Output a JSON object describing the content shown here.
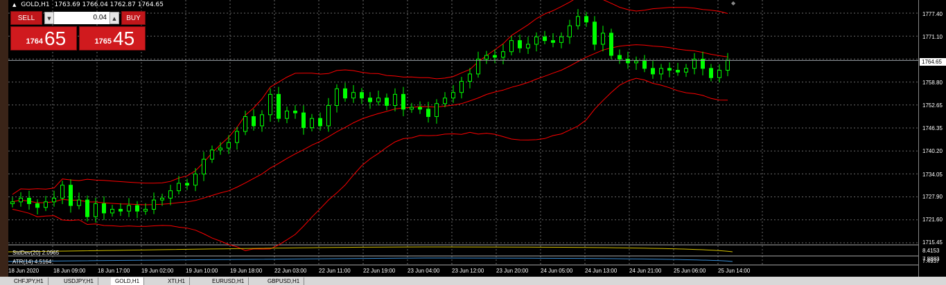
{
  "window": {
    "title": "GOLD,H1",
    "ohlc": "1763.69 1766.04 1762.87 1764.65"
  },
  "trade_panel": {
    "sell_label": "SELL",
    "buy_label": "BUY",
    "lot": "0.04",
    "sell_base": "1764",
    "sell_pips": "65",
    "buy_base": "1765",
    "buy_pips": "45"
  },
  "price_scale": {
    "ticks": [
      "1777.40",
      "1771.10",
      "1764.65",
      "1758.80",
      "1752.65",
      "1746.35",
      "1740.20",
      "1734.05",
      "1727.90",
      "1721.60",
      "1715.45"
    ],
    "current_price": "1764.65",
    "ind_ticks": [
      "8.4153",
      "7.8883",
      "7.4937"
    ]
  },
  "indicators": {
    "stddev_label": "StdDev(20) 2.0965",
    "atr_label": "ATR(14) 4.5164"
  },
  "time_axis": [
    "18 Jun 2020",
    "18 Jun 09:00",
    "18 Jun 17:00",
    "19 Jun 02:00",
    "19 Jun 10:00",
    "19 Jun 18:00",
    "22 Jun 03:00",
    "22 Jun 11:00",
    "22 Jun 19:00",
    "23 Jun 04:00",
    "23 Jun 12:00",
    "23 Jun 20:00",
    "24 Jun 05:00",
    "24 Jun 13:00",
    "24 Jun 21:00",
    "25 Jun 06:00",
    "25 Jun 14:00"
  ],
  "tabs": [
    "CHFJPY,H1",
    "USDJPY,H1",
    "GOLD,H1",
    "XTI,H1",
    "EURUSD,H1",
    "GBPUSD,H1"
  ],
  "colors": {
    "bull": "#00ff00",
    "band": "#ff0000",
    "grid": "#6b6b6b",
    "sell_bg": "#d01a1e"
  },
  "chart_data": {
    "type": "candlestick",
    "symbol": "GOLD",
    "timeframe": "H1",
    "ylim": [
      1715.45,
      1777.4
    ],
    "closes": [
      1726.5,
      1727.5,
      1726.0,
      1725.0,
      1726.5,
      1727.5,
      1731.0,
      1725.5,
      1727.0,
      1722.5,
      1726.0,
      1723.5,
      1724.5,
      1724.0,
      1725.5,
      1724.0,
      1724.5,
      1727.0,
      1727.5,
      1729.5,
      1731.5,
      1731.0,
      1734.0,
      1738.0,
      1740.5,
      1741.0,
      1742.5,
      1745.5,
      1749.5,
      1747.0,
      1750.0,
      1755.5,
      1749.0,
      1751.0,
      1750.5,
      1746.5,
      1749.0,
      1747.0,
      1752.5,
      1757.0,
      1754.5,
      1756.0,
      1754.5,
      1753.5,
      1754.5,
      1752.5,
      1755.5,
      1751.5,
      1752.0,
      1751.5,
      1749.5,
      1753.0,
      1754.5,
      1756.0,
      1759.0,
      1761.0,
      1765.0,
      1766.0,
      1765.5,
      1767.0,
      1770.0,
      1768.0,
      1769.0,
      1771.0,
      1770.0,
      1769.5,
      1771.0,
      1774.0,
      1776.5,
      1775.0,
      1769.0,
      1772.0,
      1766.0,
      1765.0,
      1764.0,
      1764.5,
      1762.5,
      1761.0,
      1762.5,
      1762.0,
      1761.5,
      1762.5,
      1765.0,
      1762.5,
      1760.0,
      1762.0,
      1764.65
    ]
  }
}
